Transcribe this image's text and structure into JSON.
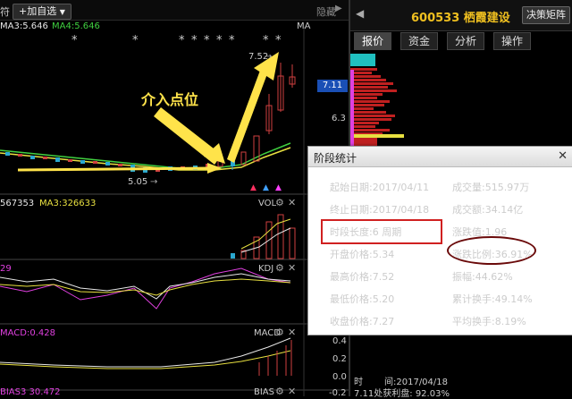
{
  "toolbar": {
    "left_fragment": "符",
    "add_self": "+加自选",
    "dropdown_icon": "chevron-down-icon",
    "hide_label": "隐藏"
  },
  "ma_legend": [
    {
      "text": "MA3:5.646",
      "color": "#e8e8e8"
    },
    {
      "text": "MA4:5.646",
      "color": "#40d040"
    }
  ],
  "ma_tag": "MA",
  "stock": {
    "code": "600533",
    "name": "栖霞建设",
    "title": "600533 栖霞建设",
    "decision_button": "决策矩阵"
  },
  "tabs": [
    "报价",
    "资金",
    "分析",
    "操作"
  ],
  "price_axis": {
    "current": "7.11",
    "label_63": "6.3"
  },
  "chart_labels": {
    "high": "7.52",
    "low": "5.05"
  },
  "annotation": "介入点位",
  "subpanels": {
    "vol": {
      "left": "567353",
      "ma": "MA3:326633",
      "tag": "VOL"
    },
    "kdj": {
      "left": "29",
      "tag": "KDJ"
    },
    "macd": {
      "left": "MACD:0.428",
      "tag": "MACD",
      "axis": [
        "0.4",
        "0.2",
        "0.0",
        "-0.2"
      ]
    },
    "bias": {
      "left": "BIAS3 30.472",
      "tag": "BIAS"
    }
  },
  "dialog": {
    "title": "阶段统计",
    "left_rows": [
      "起始日期:2017/04/11",
      "终止日期:2017/04/18",
      "时段长度:6 周期",
      "开盘价格:5.34",
      "最高价格:7.52",
      "最低价格:5.20",
      "收盘价格:7.27"
    ],
    "right_rows": [
      "成交量:515.97万",
      "成交额:34.14亿",
      "涨跌值:1.96",
      "涨跌比例:36.91%",
      "振幅:44.62%",
      "累计换手:49.14%",
      "平均换手:8.19%"
    ]
  },
  "bottom_right": {
    "time_label": "时",
    "time_value": "间:2017/04/18",
    "profit": "7.11处获利盘: 92.03%"
  }
}
